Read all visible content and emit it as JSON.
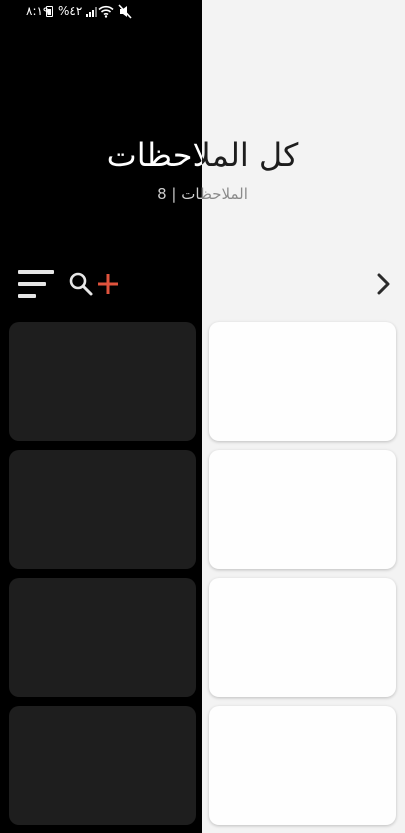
{
  "status_bar": {
    "time": "٨:١٩",
    "battery_percent": "%٤٢",
    "icons": [
      "battery-icon",
      "signal-icon",
      "wifi-icon",
      "mute-icon"
    ]
  },
  "header": {
    "title": "كل الملاحظات",
    "subtitle": "الملاحظات | 8"
  },
  "toolbar": {
    "icons": [
      "sort-icon",
      "search-icon",
      "add-icon",
      "chevron-right-icon"
    ],
    "accent_color": "#e0533d"
  },
  "notes": {
    "count": 8,
    "left_column_color": "#1e1e1e",
    "right_column_color": "#fefefe"
  },
  "theme": {
    "left_background": "#000000",
    "right_background": "#f3f3f3"
  }
}
